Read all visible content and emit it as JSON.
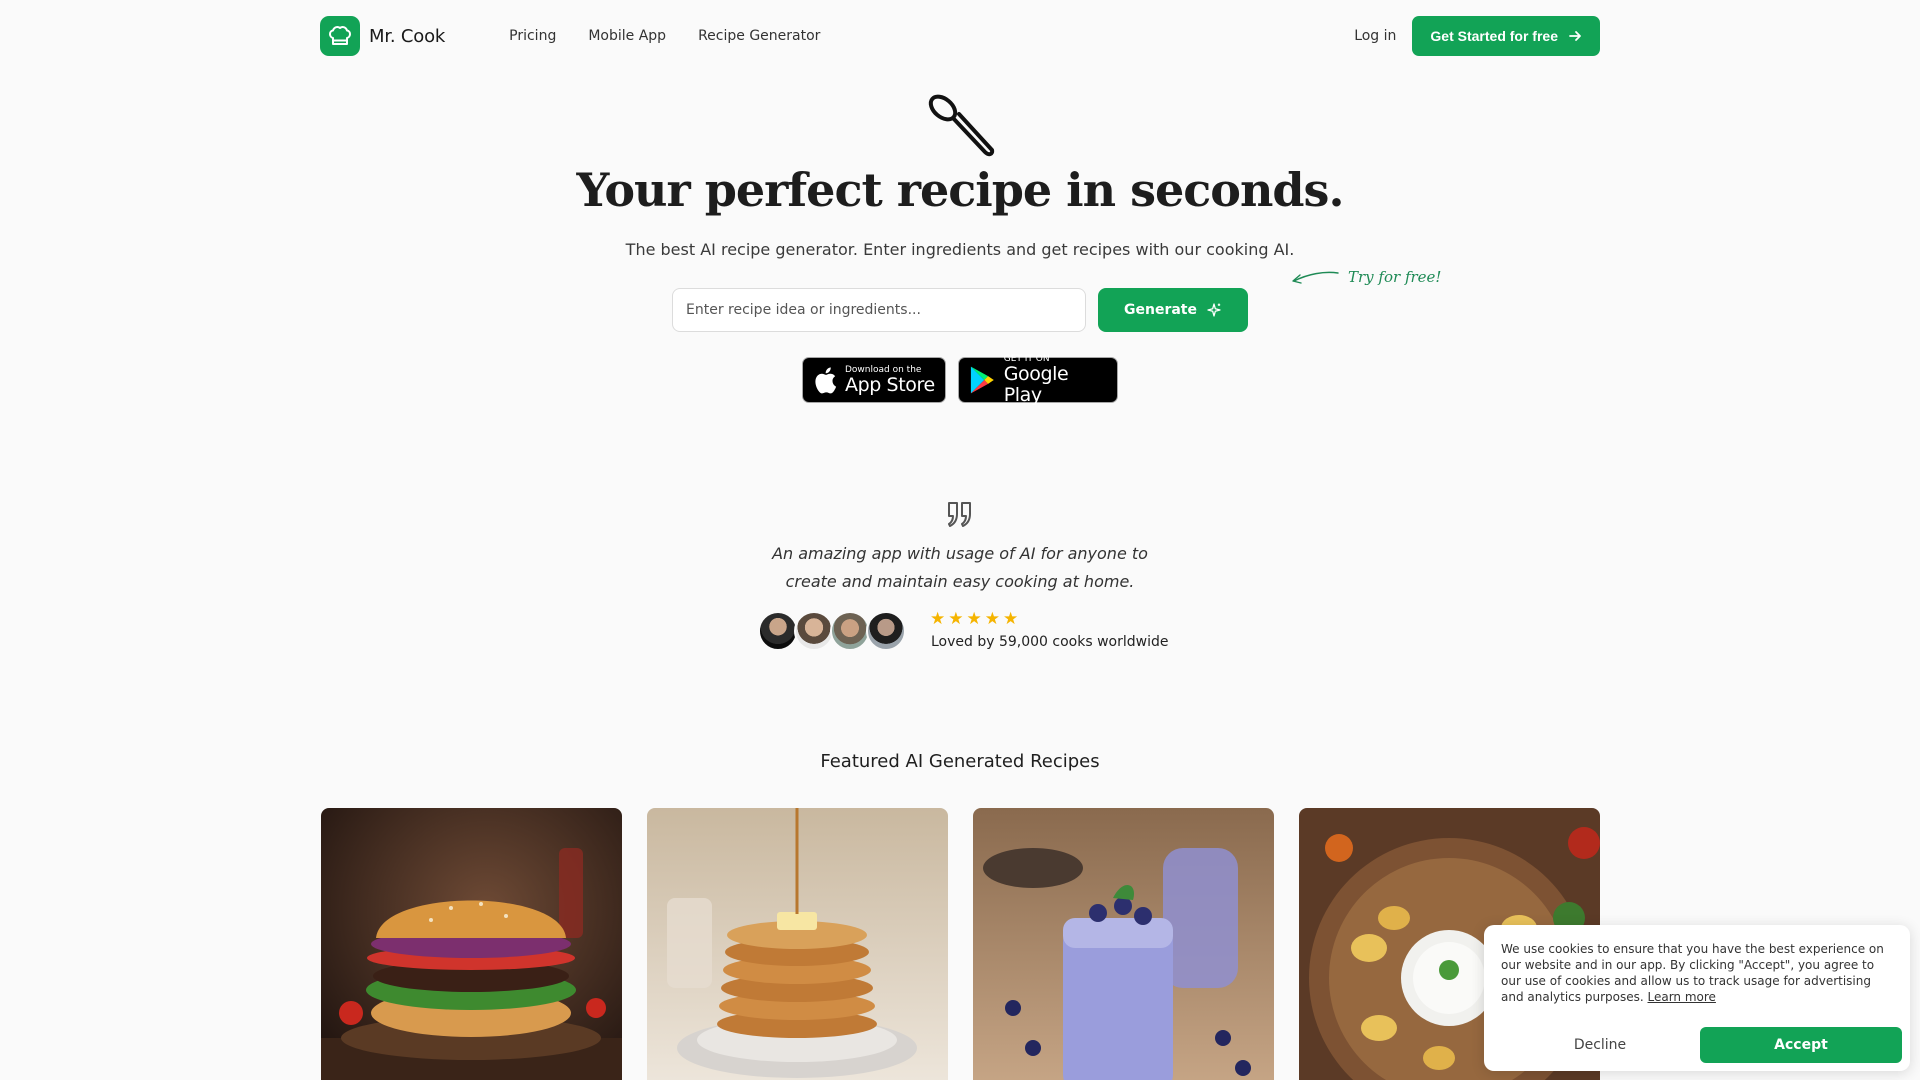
{
  "nav": {
    "logo_text": "Mr. Cook",
    "links": [
      "Pricing",
      "Mobile App",
      "Recipe Generator"
    ],
    "login": "Log in",
    "cta": "Get Started for free"
  },
  "hero": {
    "title": "Your perfect recipe in seconds.",
    "subtitle": "The best AI recipe generator. Enter ingredients and get recipes with our cooking AI.",
    "input_placeholder": "Enter recipe idea or ingredients...",
    "generate_label": "Generate",
    "try_free": "Try for free!"
  },
  "stores": {
    "app_store_small": "Download on the",
    "app_store_big": "App Store",
    "google_small": "GET IT ON",
    "google_big": "Google Play"
  },
  "testimonial": {
    "quote": "An amazing app with usage of AI for anyone to create and maintain easy cooking at home.",
    "rating": 5,
    "loved": "Loved by 59,000 cooks worldwide"
  },
  "featured": {
    "title": "Featured AI Generated Recipes",
    "cards": [
      "burger-image",
      "pancakes-image",
      "blueberry-smoothie-image",
      "chips-dip-image"
    ]
  },
  "cookie": {
    "text": "We use cookies to ensure that you have the best experience on our website and in our app. By clicking \"Accept\", you agree to our use of cookies and allow us to track usage for advertising and analytics purposes.",
    "learn_more": "Learn more",
    "decline": "Decline",
    "accept": "Accept"
  },
  "colors": {
    "brand_green": "#12a356",
    "star": "#f5b400",
    "background": "#fafafa"
  }
}
